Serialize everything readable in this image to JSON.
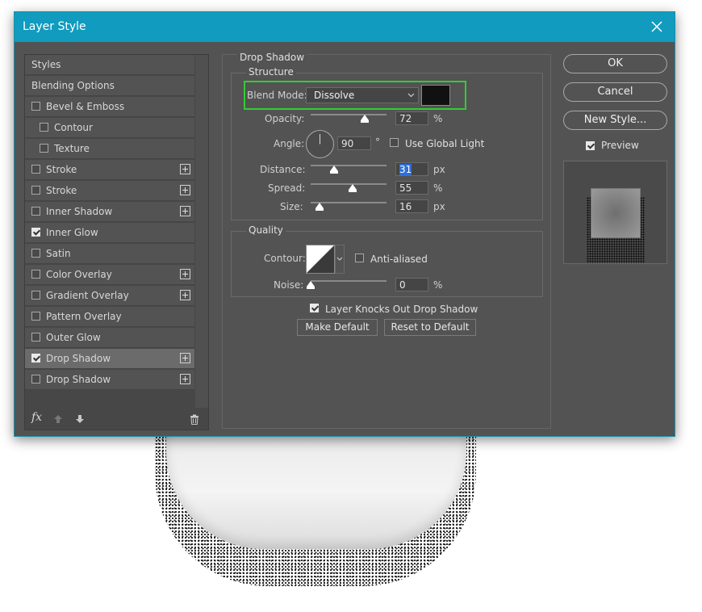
{
  "dialog": {
    "title": "Layer Style"
  },
  "styles_list": {
    "items": [
      {
        "label": "Styles",
        "checkbox": false,
        "checked": false,
        "plus": false,
        "indent": 0,
        "selected": false
      },
      {
        "label": "Blending Options",
        "checkbox": false,
        "checked": false,
        "plus": false,
        "indent": 0,
        "selected": false
      },
      {
        "label": "Bevel & Emboss",
        "checkbox": true,
        "checked": false,
        "plus": false,
        "indent": 0,
        "selected": false
      },
      {
        "label": "Contour",
        "checkbox": true,
        "checked": false,
        "plus": false,
        "indent": 1,
        "selected": false
      },
      {
        "label": "Texture",
        "checkbox": true,
        "checked": false,
        "plus": false,
        "indent": 1,
        "selected": false
      },
      {
        "label": "Stroke",
        "checkbox": true,
        "checked": false,
        "plus": true,
        "indent": 0,
        "selected": false
      },
      {
        "label": "Stroke",
        "checkbox": true,
        "checked": false,
        "plus": true,
        "indent": 0,
        "selected": false
      },
      {
        "label": "Inner Shadow",
        "checkbox": true,
        "checked": false,
        "plus": true,
        "indent": 0,
        "selected": false
      },
      {
        "label": "Inner Glow",
        "checkbox": true,
        "checked": true,
        "plus": false,
        "indent": 0,
        "selected": false
      },
      {
        "label": "Satin",
        "checkbox": true,
        "checked": false,
        "plus": false,
        "indent": 0,
        "selected": false
      },
      {
        "label": "Color Overlay",
        "checkbox": true,
        "checked": false,
        "plus": true,
        "indent": 0,
        "selected": false
      },
      {
        "label": "Gradient Overlay",
        "checkbox": true,
        "checked": false,
        "plus": true,
        "indent": 0,
        "selected": false
      },
      {
        "label": "Pattern Overlay",
        "checkbox": true,
        "checked": false,
        "plus": false,
        "indent": 0,
        "selected": false
      },
      {
        "label": "Outer Glow",
        "checkbox": true,
        "checked": false,
        "plus": false,
        "indent": 0,
        "selected": false
      },
      {
        "label": "Drop Shadow",
        "checkbox": true,
        "checked": true,
        "plus": true,
        "indent": 0,
        "selected": true
      },
      {
        "label": "Drop Shadow",
        "checkbox": true,
        "checked": false,
        "plus": true,
        "indent": 0,
        "selected": false
      }
    ],
    "footer": {
      "fx_label": "fx"
    }
  },
  "drop_shadow": {
    "group_title": "Drop Shadow",
    "structure_title": "Structure",
    "blend_mode_label": "Blend Mode:",
    "blend_mode_value": "Dissolve",
    "shadow_color": "#111111",
    "highlight_color": "#33cc33",
    "opacity_label": "Opacity:",
    "opacity_value": "72",
    "opacity_unit": "%",
    "angle_label": "Angle:",
    "angle_value": "90",
    "angle_unit": "°",
    "global_light_label": "Use Global Light",
    "global_light_checked": false,
    "distance_label": "Distance:",
    "distance_value": "31",
    "distance_unit": "px",
    "spread_label": "Spread:",
    "spread_value": "55",
    "spread_unit": "%",
    "size_label": "Size:",
    "size_value": "16",
    "size_unit": "px",
    "quality_title": "Quality",
    "contour_label": "Contour:",
    "anti_aliased_label": "Anti-aliased",
    "anti_aliased_checked": false,
    "noise_label": "Noise:",
    "noise_value": "0",
    "noise_unit": "%",
    "knocks_out_label": "Layer Knocks Out Drop Shadow",
    "knocks_out_checked": true,
    "make_default_label": "Make Default",
    "reset_default_label": "Reset to Default"
  },
  "buttons": {
    "ok": "OK",
    "cancel": "Cancel",
    "new_style": "New Style..."
  },
  "preview": {
    "label": "Preview",
    "checked": true
  },
  "colors": {
    "title_bar": "#109bbf",
    "dialog_bg": "#535353",
    "highlight_border": "#33cc33"
  }
}
